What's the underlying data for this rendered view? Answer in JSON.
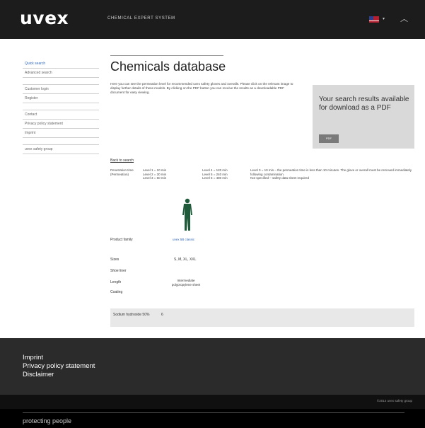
{
  "header": {
    "logo": "uvex",
    "app_title": "CHEMICAL EXPERT SYSTEM",
    "language_flag": "uk-flag-icon",
    "language_caret": "▾",
    "scroll_top": "︿"
  },
  "sidebar": {
    "items": [
      {
        "label": "Quick search",
        "active": true
      },
      {
        "label": "Advanced search"
      },
      {
        "label": "Customer login"
      },
      {
        "label": "Register"
      },
      {
        "label": "Contact"
      },
      {
        "label": "Privacy policy statement"
      },
      {
        "label": "Imprint"
      },
      {
        "label": "uvex safety group"
      }
    ]
  },
  "main": {
    "title": "Chemicals database",
    "intro": "Here you can see the permeation level for recommended uvex safety gloves and overalls. Please click on the relevant image to display further details of these models. By clicking on the PDF button you can receive the results as a downloadable PDF document for easy viewing.",
    "pdf_box": {
      "text": "Your search results available for download as a PDF",
      "button": "PDF"
    },
    "back_link": "Back to search",
    "permeation": {
      "label": "Penetration time (Permeation)",
      "levels_col1": "Level 1 = 10 min\nLevel 2 = 30 min\nLevel 3 = 60 min",
      "levels_col2": "Level 4 = 120 min\nLevel 5 = 240 min\nLevel 6 = 480 min",
      "note": "Level 0 = 10 min – the permeation time is less than 10 minutes. The glove or overall must be removed immediately following contamination.\nNot specified – safety data sheet required"
    },
    "product": {
      "family_label": "Product family",
      "family_value": "uvex 5B classic",
      "sizes_label": "Sizes",
      "sizes_value": "S, M, XL, XXL",
      "shoe_label": "Shoe liner",
      "length_label": "Length",
      "length_value": "Intermediate polypropylene sheet",
      "coating_label": "Coating"
    },
    "chemical": {
      "name": "Sodium hydroxide 50%",
      "level": "6"
    }
  },
  "footer": {
    "links": [
      "Imprint",
      "Privacy policy statement",
      "Disclaimer"
    ],
    "copyright": "©2014 uvex safety group",
    "slogan": "protecting people"
  },
  "colors": {
    "topbar": "#1c1c1c",
    "active_link": "#2e66b8",
    "footer": "#2b2b2b",
    "pdf_box": "#d9d9d9",
    "overall_figure": "#1f5a3a"
  }
}
